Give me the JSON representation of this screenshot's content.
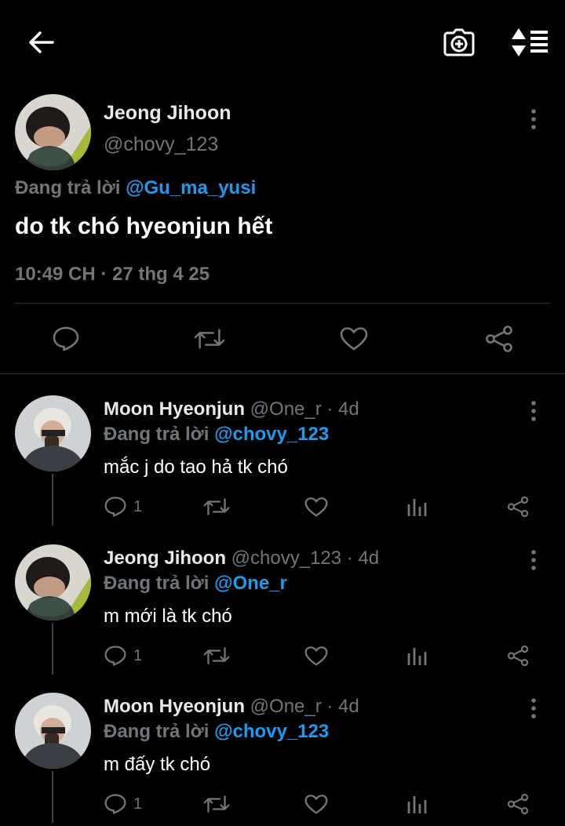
{
  "colors": {
    "background": "#000000",
    "accent": "#1d9bf0",
    "muted": "#71767b",
    "divider": "#2f3336"
  },
  "topbar": {
    "icons": [
      "back-arrow-icon",
      "camera-plus-icon",
      "sort-icon"
    ]
  },
  "tweet": {
    "name": "Jeong Jihoon",
    "handle": "@chovy_123",
    "replying_prefix": "Đang trả lời",
    "replying_to": "@Gu_ma_yusi",
    "text": "do tk chó hyeonjun hết",
    "meta": "10:49 CH · 27 thg 4 25"
  },
  "replies": [
    {
      "name": "Moon Hyeonjun",
      "handle_time": "@One_r · 4d",
      "replying_prefix": "Đang trả lời",
      "replying_to": "@chovy_123",
      "text": "mắc j do tao hả tk chó",
      "reply_count": "1"
    },
    {
      "name": "Jeong Jihoon",
      "handle_time": "@chovy_123 · 4d",
      "replying_prefix": "Đang trả lời",
      "replying_to": "@One_r",
      "text": "m mới là tk chó",
      "reply_count": "1"
    },
    {
      "name": "Moon Hyeonjun",
      "handle_time": "@One_r · 4d",
      "replying_prefix": "Đang trả lời",
      "replying_to": "@chovy_123",
      "text": "m đấy tk chó",
      "reply_count": "1"
    }
  ]
}
